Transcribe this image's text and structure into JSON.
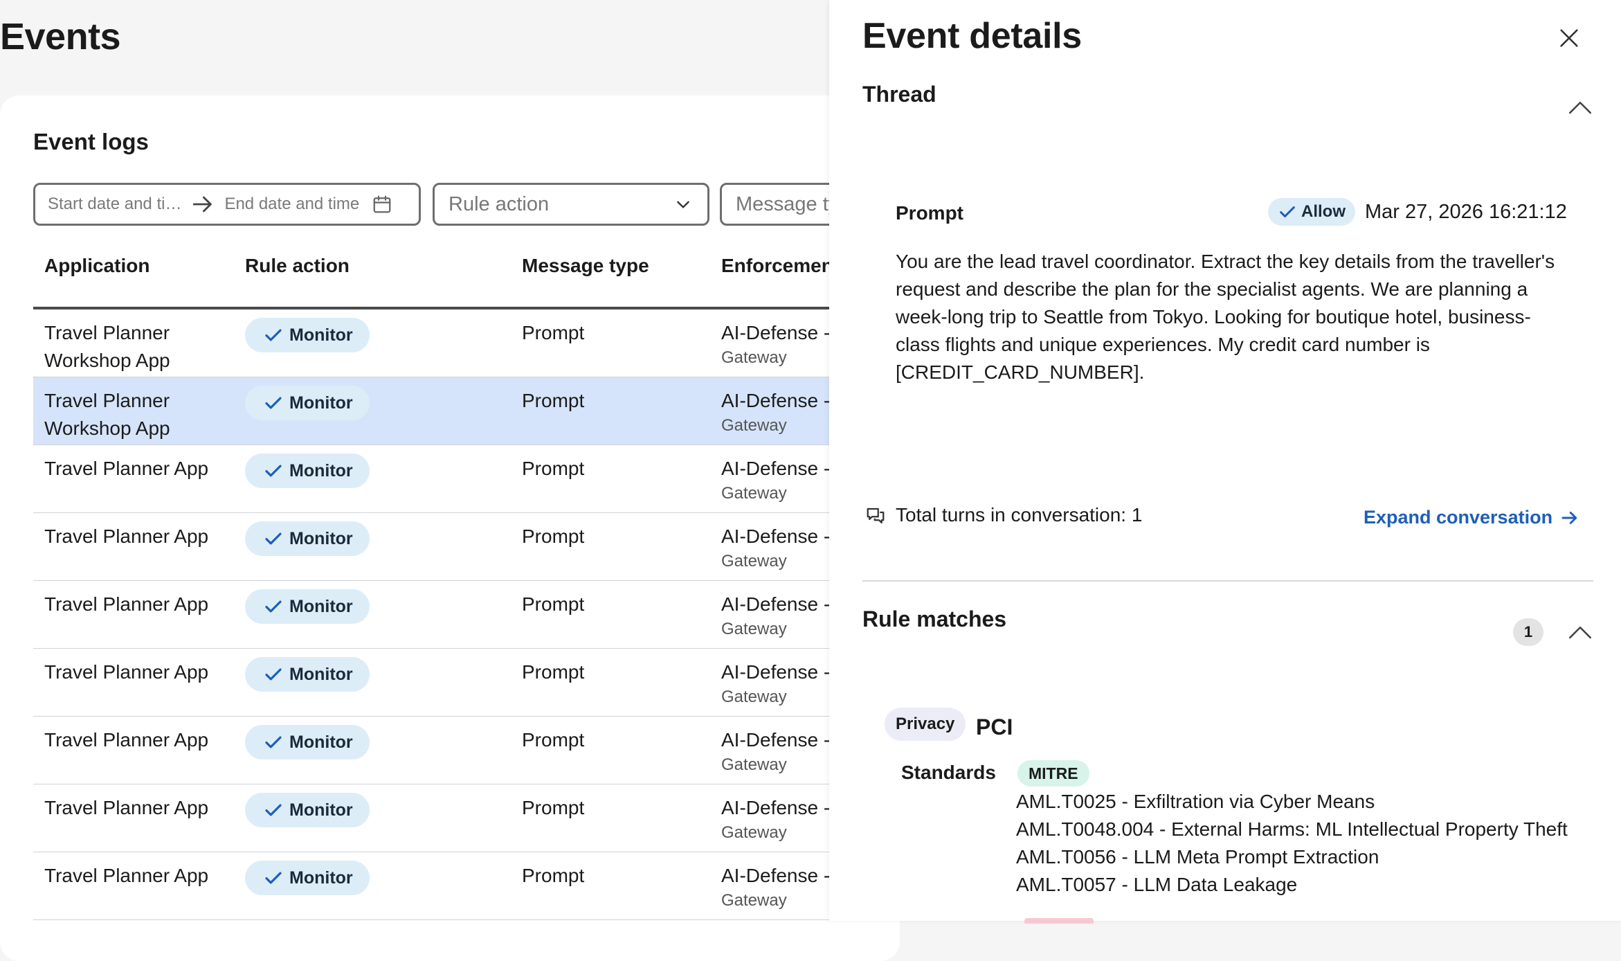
{
  "page": {
    "title": "Events"
  },
  "event_logs": {
    "title": "Event logs",
    "filters": {
      "start_placeholder": "Start date and ti…",
      "end_placeholder": "End date and time",
      "rule_action_placeholder": "Rule action",
      "message_type_placeholder": "Message ty"
    },
    "columns": [
      "Application",
      "Rule action",
      "Message type",
      "Enforcemen"
    ],
    "rows": [
      {
        "application": "Travel Planner Workshop App",
        "rule_action": "Monitor",
        "message_type": "Prompt",
        "enforcement": "AI-Defense -",
        "enforcement_sub": "Gateway",
        "selected": false
      },
      {
        "application": "Travel Planner Workshop App",
        "rule_action": "Monitor",
        "message_type": "Prompt",
        "enforcement": "AI-Defense -",
        "enforcement_sub": "Gateway",
        "selected": true
      },
      {
        "application": "Travel Planner App",
        "rule_action": "Monitor",
        "message_type": "Prompt",
        "enforcement": "AI-Defense -",
        "enforcement_sub": "Gateway",
        "selected": false
      },
      {
        "application": "Travel Planner App",
        "rule_action": "Monitor",
        "message_type": "Prompt",
        "enforcement": "AI-Defense -",
        "enforcement_sub": "Gateway",
        "selected": false
      },
      {
        "application": "Travel Planner App",
        "rule_action": "Monitor",
        "message_type": "Prompt",
        "enforcement": "AI-Defense -",
        "enforcement_sub": "Gateway",
        "selected": false
      },
      {
        "application": "Travel Planner App",
        "rule_action": "Monitor",
        "message_type": "Prompt",
        "enforcement": "AI-Defense -",
        "enforcement_sub": "Gateway",
        "selected": false
      },
      {
        "application": "Travel Planner App",
        "rule_action": "Monitor",
        "message_type": "Prompt",
        "enforcement": "AI-Defense -",
        "enforcement_sub": "Gateway",
        "selected": false
      },
      {
        "application": "Travel Planner App",
        "rule_action": "Monitor",
        "message_type": "Prompt",
        "enforcement": "AI-Defense -",
        "enforcement_sub": "Gateway",
        "selected": false
      },
      {
        "application": "Travel Planner App",
        "rule_action": "Monitor",
        "message_type": "Prompt",
        "enforcement": "AI-Defense -",
        "enforcement_sub": "Gateway",
        "selected": false
      }
    ]
  },
  "drawer": {
    "title": "Event details",
    "thread": {
      "title": "Thread",
      "prompt_label": "Prompt",
      "action_badge": "Allow",
      "timestamp": "Mar 27, 2026 16:21:12",
      "prompt_text": "You are the lead travel coordinator. Extract the key details from the traveller's request and describe the plan for the specialist agents. We are planning a week-long trip to Seattle from Tokyo. Looking for boutique hotel, business-class flights and unique experiences. My credit card number is [CREDIT_CARD_NUMBER].",
      "total_turns": "Total turns in conversation: 1",
      "expand_label": "Expand conversation"
    },
    "rule_matches": {
      "title": "Rule matches",
      "count": "1",
      "category": "Privacy",
      "rule_name": "PCI",
      "standards_label": "Standards",
      "standard": "MITRE",
      "techniques": [
        "AML.T0025 - Exfiltration via Cyber Means",
        "AML.T0048.004 - External Harms: ML Intellectual Property Theft",
        "AML.T0056 - LLM Meta Prompt Extraction",
        "AML.T0057 - LLM Data Leakage"
      ]
    }
  },
  "colors": {
    "accent_link": "#1e5fb8",
    "selected_row": "#d5e4fa",
    "monitor_badge": "#dcedf8",
    "mitre_badge": "#d7f3ea",
    "privacy_badge": "#ececf6"
  }
}
